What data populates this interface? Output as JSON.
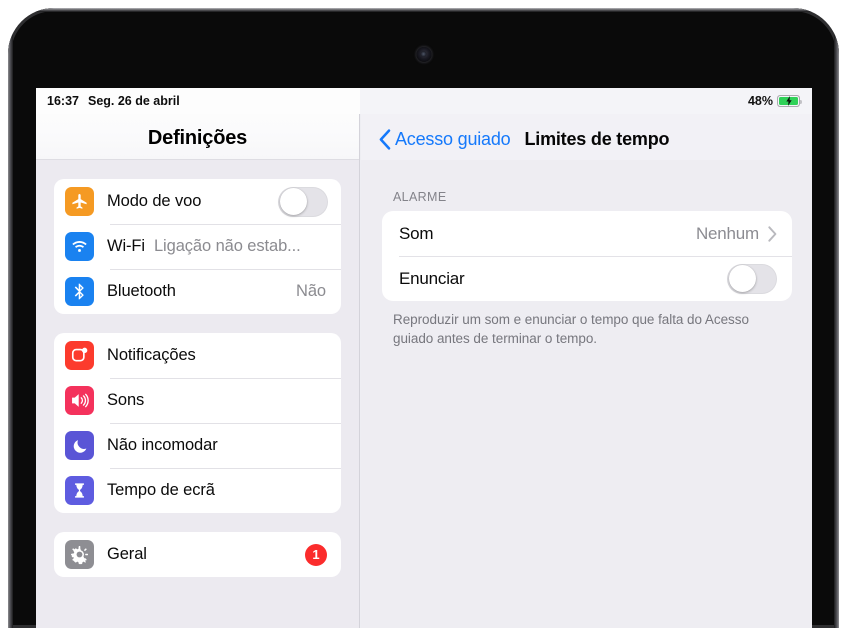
{
  "status_bar": {
    "time": "16:37",
    "date": "Seg. 26 de abril",
    "battery_percent": "48%",
    "battery_icon": "battery-charging-icon",
    "battery_color": "#2fd158"
  },
  "sidebar": {
    "title": "Definições",
    "groups": [
      {
        "rows": [
          {
            "label": "Modo de voo",
            "icon": "airplane-icon",
            "icon_color": "#f59a23",
            "control": "toggle",
            "toggle_on": false
          },
          {
            "label": "Wi-Fi",
            "icon": "wifi-icon",
            "icon_color": "#1a82f0",
            "control": "value-inline",
            "value": "Ligação não estab..."
          },
          {
            "label": "Bluetooth",
            "icon": "bluetooth-icon",
            "icon_color": "#1a82f0",
            "control": "value-right",
            "value": "Não"
          }
        ]
      },
      {
        "rows": [
          {
            "label": "Notificações",
            "icon": "notifications-icon",
            "icon_color": "#fc3b2d",
            "control": "none"
          },
          {
            "label": "Sons",
            "icon": "speaker-icon",
            "icon_color": "#f4325c",
            "control": "none"
          },
          {
            "label": "Não incomodar",
            "icon": "moon-icon",
            "icon_color": "#5a55d6",
            "control": "none"
          },
          {
            "label": "Tempo de ecrã",
            "icon": "hourglass-icon",
            "icon_color": "#5e5ce0",
            "control": "none"
          }
        ]
      },
      {
        "rows": [
          {
            "label": "Geral",
            "icon": "gear-icon",
            "icon_color": "#8e8e93",
            "control": "badge",
            "badge": "1",
            "badge_color": "#fb2c2c"
          }
        ]
      }
    ]
  },
  "detail": {
    "back_label": "Acesso guiado",
    "back_icon": "chevron-left-icon",
    "back_color": "#1579fb",
    "title": "Limites de tempo",
    "section_header": "ALARME",
    "rows": [
      {
        "label": "Som",
        "value": "Nenhum",
        "control": "disclosure",
        "icon": "chevron-right-icon"
      },
      {
        "label": "Enunciar",
        "control": "toggle",
        "toggle_on": false
      }
    ],
    "footer_note": "Reproduzir um som e enunciar o tempo que falta do Acesso guiado antes de terminar o tempo."
  }
}
